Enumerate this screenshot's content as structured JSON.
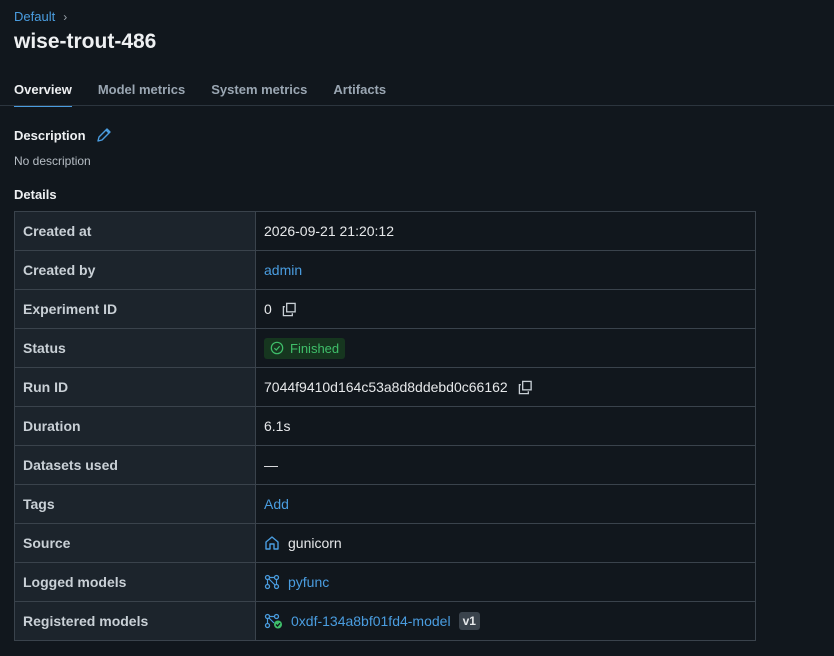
{
  "breadcrumb": {
    "parent": "Default"
  },
  "page": {
    "title": "wise-trout-486"
  },
  "tabs": [
    {
      "label": "Overview"
    },
    {
      "label": "Model metrics"
    },
    {
      "label": "System metrics"
    },
    {
      "label": "Artifacts"
    }
  ],
  "description": {
    "title": "Description",
    "text": "No description"
  },
  "details": {
    "title": "Details",
    "rows": {
      "created_at": {
        "key": "Created at",
        "value": "2026-09-21 21:20:12"
      },
      "created_by": {
        "key": "Created by",
        "value": "admin"
      },
      "experiment_id": {
        "key": "Experiment ID",
        "value": "0"
      },
      "status": {
        "key": "Status",
        "value": "Finished"
      },
      "run_id": {
        "key": "Run ID",
        "value": "7044f9410d164c53a8d8ddebd0c66162"
      },
      "duration": {
        "key": "Duration",
        "value": "6.1s"
      },
      "datasets": {
        "key": "Datasets used",
        "value": "—"
      },
      "tags": {
        "key": "Tags",
        "value": "Add"
      },
      "source": {
        "key": "Source",
        "value": "gunicorn"
      },
      "logged_models": {
        "key": "Logged models",
        "value": "pyfunc"
      },
      "registered_models": {
        "key": "Registered models",
        "value": "0xdf-134a8bf01fd4-model",
        "version": "v1"
      }
    }
  },
  "colors": {
    "background": "#11171d",
    "accent": "#4a9de0",
    "status_success": "#3fbf6a"
  },
  "icons": [
    "chevron-right-icon",
    "pencil-icon",
    "copy-icon",
    "check-circle-icon",
    "source-icon",
    "model-icon",
    "registered-model-icon"
  ]
}
